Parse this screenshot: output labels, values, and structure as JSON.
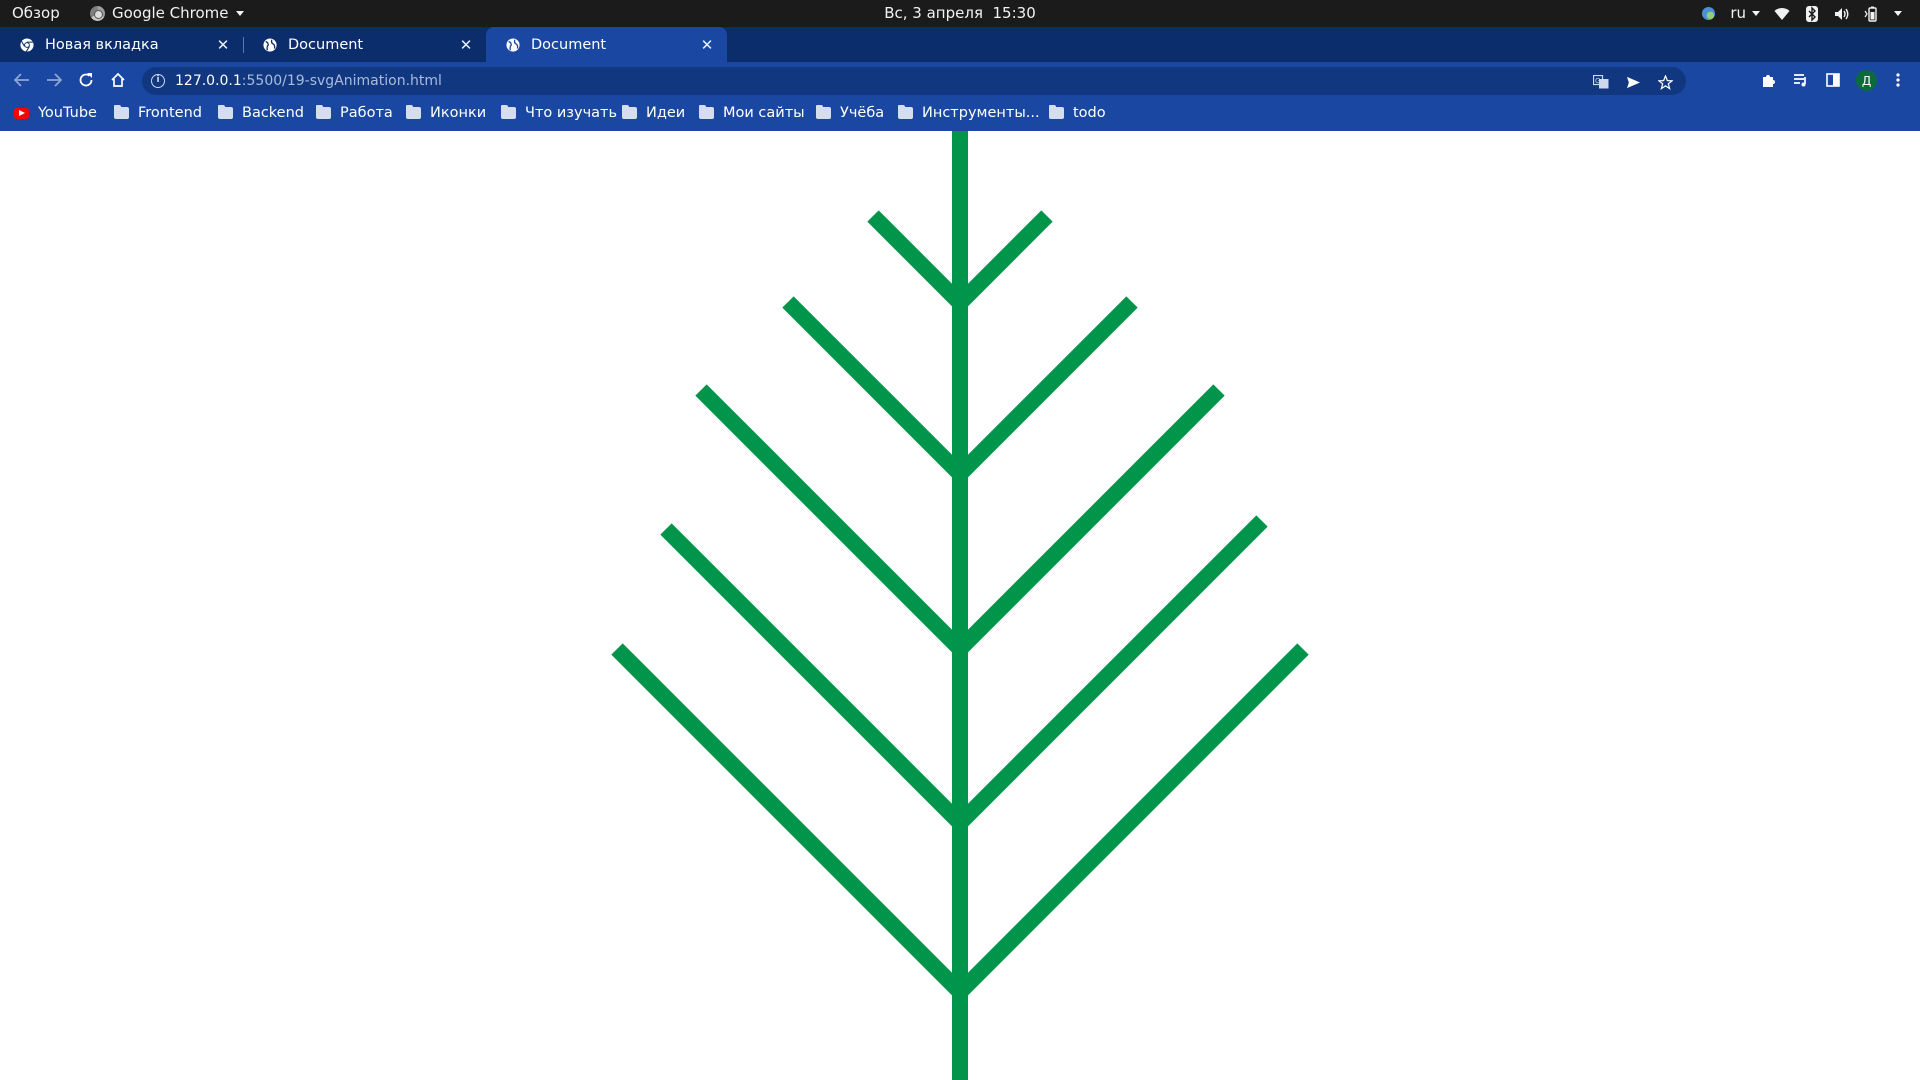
{
  "topbar": {
    "activities": "Обзор",
    "app_name": "Google Chrome",
    "clock": "Вс, 3 апреля  15:30",
    "input_language": "ru"
  },
  "tabs": [
    {
      "title": "Новая вкладка",
      "icon": "chrome-icon",
      "active": false
    },
    {
      "title": "Document",
      "icon": "globe-icon",
      "active": false
    },
    {
      "title": "Document",
      "icon": "globe-icon",
      "active": true
    }
  ],
  "toolbar": {
    "url_host": "127.0.0.1",
    "url_path": ":5500/19-svgAnimation.html",
    "avatar_letter": "Д"
  },
  "bookmarks": [
    {
      "label": "YouTube",
      "icon": "youtube-icon"
    },
    {
      "label": "Frontend",
      "icon": "folder-icon"
    },
    {
      "label": "Backend",
      "icon": "folder-icon"
    },
    {
      "label": "Работа",
      "icon": "folder-icon"
    },
    {
      "label": "Иконки",
      "icon": "folder-icon"
    },
    {
      "label": "Что изучать",
      "icon": "folder-icon"
    },
    {
      "label": "Идеи",
      "icon": "folder-icon"
    },
    {
      "label": "Мои сайты",
      "icon": "folder-icon"
    },
    {
      "label": "Учёба",
      "icon": "folder-icon"
    },
    {
      "label": "Инструменты...",
      "icon": "folder-icon"
    },
    {
      "label": "todo",
      "icon": "folder-icon"
    }
  ],
  "colors": {
    "tree_stroke": "#00954a",
    "chrome_frame": "#0c2d6b",
    "chrome_toolbar": "#1a47a1",
    "os_topbar": "#1b1b1b"
  }
}
